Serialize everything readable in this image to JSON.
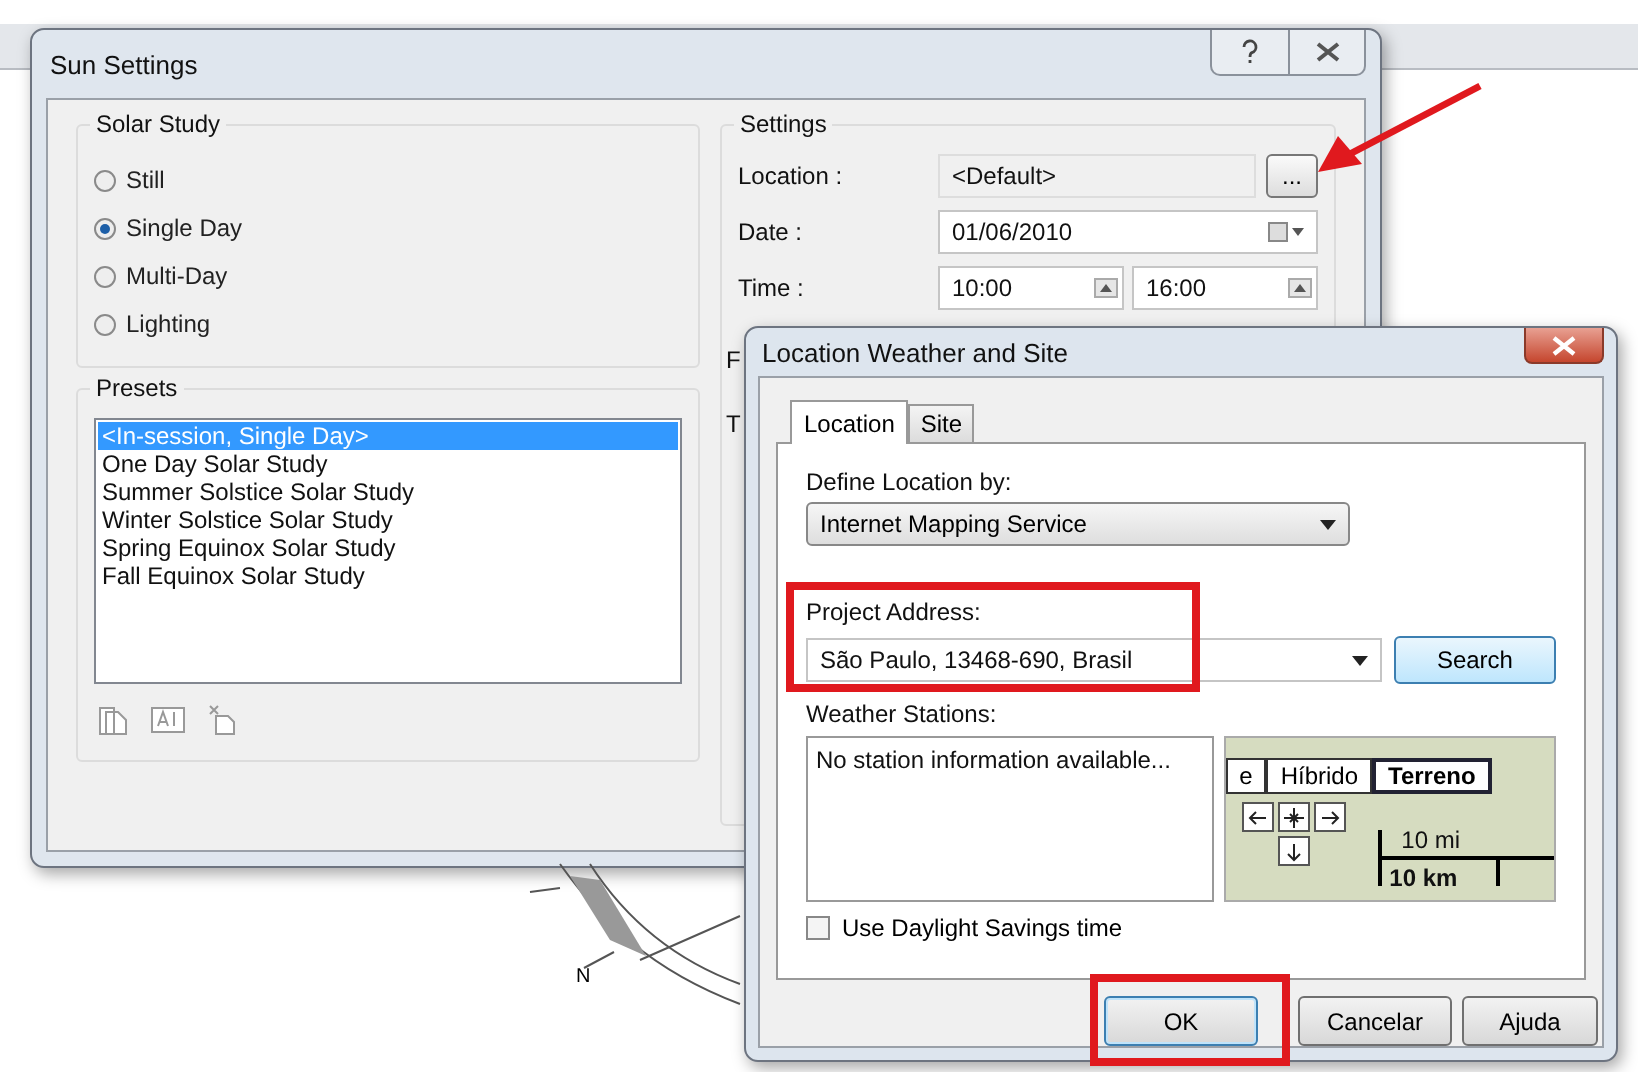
{
  "sun_settings": {
    "title": "Sun Settings",
    "solar_study": {
      "label": "Solar Study",
      "options": [
        {
          "label": "Still",
          "selected": false
        },
        {
          "label": "Single Day",
          "selected": true
        },
        {
          "label": "Multi-Day",
          "selected": false
        },
        {
          "label": "Lighting",
          "selected": false
        }
      ]
    },
    "presets": {
      "label": "Presets",
      "items": [
        {
          "label": "<In-session, Single Day>",
          "selected": true
        },
        {
          "label": "One Day Solar Study",
          "selected": false
        },
        {
          "label": "Summer Solstice Solar Study",
          "selected": false
        },
        {
          "label": "Winter Solstice Solar Study",
          "selected": false
        },
        {
          "label": "Spring Equinox Solar Study",
          "selected": false
        },
        {
          "label": "Fall Equinox Solar Study",
          "selected": false
        }
      ]
    },
    "settings": {
      "label": "Settings",
      "location": {
        "label": "Location :",
        "value": "<Default>",
        "browse": "..."
      },
      "date": {
        "label": "Date :",
        "value": "01/06/2010"
      },
      "time": {
        "label": "Time :",
        "start": "10:00",
        "end": "16:00"
      },
      "covered_labels": [
        "F",
        "T"
      ]
    }
  },
  "location_dialog": {
    "title": "Location Weather and Site",
    "tabs": [
      {
        "label": "Location",
        "selected": true
      },
      {
        "label": "Site",
        "selected": false
      }
    ],
    "define_by": {
      "label": "Define Location by:",
      "value": "Internet Mapping Service"
    },
    "project_address": {
      "label": "Project Address:",
      "value": "São Paulo, 13468-690, Brasil",
      "search": "Search"
    },
    "weather_stations": {
      "label": "Weather Stations:",
      "message": "No station information available..."
    },
    "map": {
      "types": [
        {
          "label": "e",
          "selected": false
        },
        {
          "label": "Híbrido",
          "selected": false
        },
        {
          "label": "Terreno",
          "selected": true
        }
      ],
      "scale_miles": "10 mi",
      "scale_km": "10 km"
    },
    "daylight_savings": {
      "label": "Use Daylight Savings time",
      "checked": false
    },
    "buttons": [
      {
        "label": "OK",
        "default": true
      },
      {
        "label": "Cancelar",
        "default": false
      },
      {
        "label": "Ajuda",
        "default": false
      }
    ]
  },
  "compass": {
    "north": "N"
  }
}
